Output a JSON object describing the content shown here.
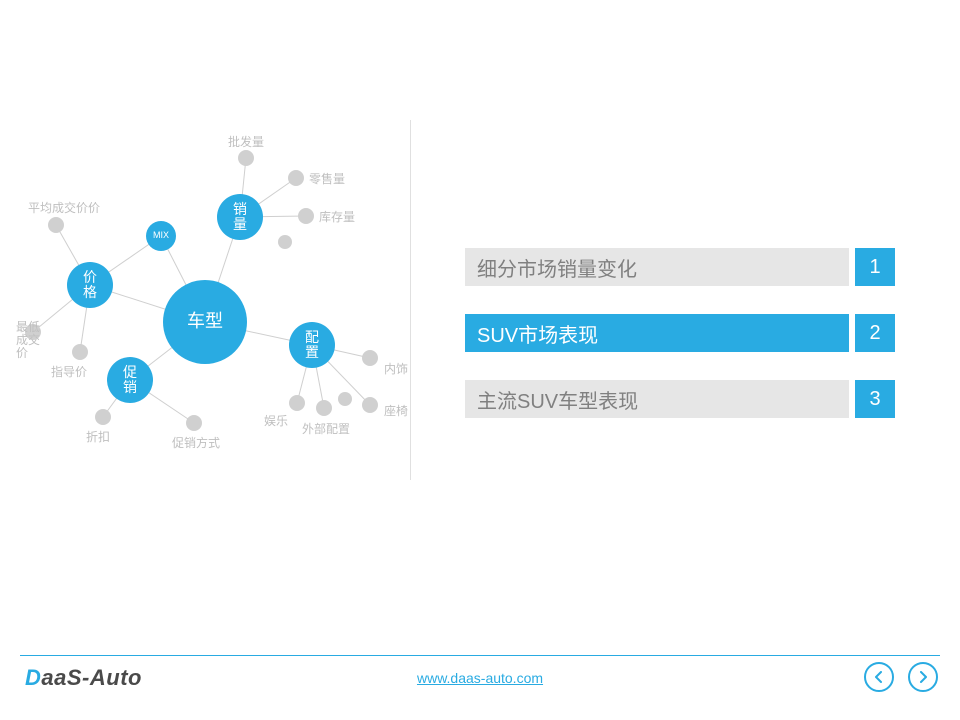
{
  "toc": {
    "items": [
      {
        "label": "细分市场销量变化",
        "num": "1",
        "active": false
      },
      {
        "label": "SUV市场表现",
        "num": "2",
        "active": true
      },
      {
        "label": "主流SUV车型表现",
        "num": "3",
        "active": false
      }
    ]
  },
  "diagram": {
    "center": "车型",
    "hubs": {
      "price": {
        "label": "价\n格"
      },
      "sales": {
        "label": "销\n量"
      },
      "config": {
        "label": "配\n置"
      },
      "promo": {
        "label": "促\n销"
      },
      "mix": {
        "label": "MIX"
      }
    },
    "leaf_labels": {
      "avg_price": "平均成交价价",
      "min_price": "最低\n成交\n价",
      "msrp": "指导价",
      "wholesale": "批发量",
      "retail": "零售量",
      "inventory": "库存量",
      "interior": "内饰",
      "seat": "座椅",
      "ext_config": "外部配置",
      "entertain": "娱乐",
      "discount": "折扣",
      "promo_method": "促销方式"
    }
  },
  "footer": {
    "logo_prefix": "D",
    "logo_rest": "aaS-Auto",
    "link_text": "www.daas-auto.com",
    "link_href": "http://www.daas-auto.com"
  }
}
